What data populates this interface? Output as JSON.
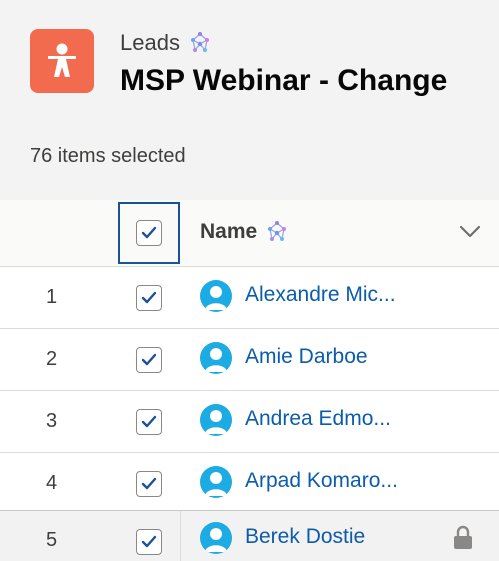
{
  "header": {
    "object_label": "Leads",
    "title": "MSP Webinar - Change",
    "selected_count": "76 items selected",
    "brand_color": "#f26b4f"
  },
  "table": {
    "columns": [
      {
        "label": "Name",
        "sortable": true
      }
    ],
    "header_checkbox_checked": true,
    "rows": [
      {
        "num": "1",
        "name": "Alexandre Mic...",
        "checked": true,
        "locked": false
      },
      {
        "num": "2",
        "name": "Amie Darboe",
        "checked": true,
        "locked": false
      },
      {
        "num": "3",
        "name": "Andrea Edmo...",
        "checked": true,
        "locked": false
      },
      {
        "num": "4",
        "name": "Arpad Komaro...",
        "checked": true,
        "locked": false
      },
      {
        "num": "5",
        "name": "Berek Dostie",
        "checked": true,
        "locked": true
      }
    ]
  },
  "icons": {
    "object": "lead-person-icon",
    "sparkle": "network-sparkle-icon",
    "chevron": "chevron-down-icon",
    "avatar": "contact-avatar-icon",
    "lock": "lock-icon",
    "check": "checkmark-icon"
  }
}
